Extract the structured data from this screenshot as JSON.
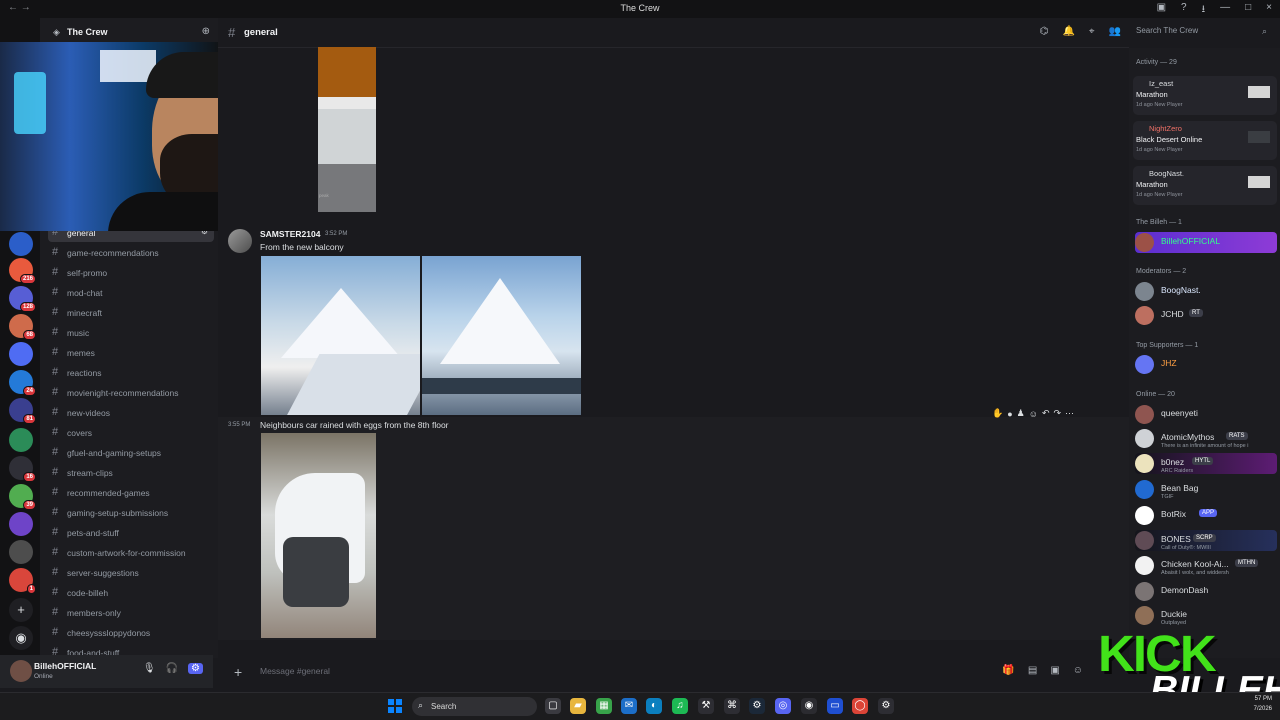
{
  "window": {
    "title": "The Crew",
    "nav": "←  →",
    "icons": [
      "inbox-icon",
      "help-icon",
      "download-icon",
      "minimize-icon",
      "maximize-icon",
      "close-icon"
    ]
  },
  "server": {
    "name": "The Crew",
    "add_icon": "add-member-icon"
  },
  "channels": [
    "general",
    "game-recommendations",
    "self-promo",
    "mod-chat",
    "minecraft",
    "music",
    "memes",
    "reactions",
    "movienight-recommendations",
    "new-videos",
    "covers",
    "gfuel-and-gaming-setups",
    "stream-clips",
    "recommended-games",
    "gaming-setup-submissions",
    "pets-and-stuff",
    "custom-artwork-for-commission",
    "server-suggestions",
    "code-billeh",
    "members-only",
    "cheesysssloppydonos",
    "food-and-stuff"
  ],
  "guild_badges": [
    "216",
    "128",
    "68",
    "24",
    "81",
    "16",
    "39",
    "1"
  ],
  "header": {
    "channel": "general",
    "search_placeholder": "Search The Crew"
  },
  "messages": [
    {
      "author": "SAMSTER2104",
      "time": "3:52 PM",
      "text": "From the new balcony"
    },
    {
      "time": "3:55 PM",
      "text": "Neighbours car rained with eggs from the 8th floor"
    }
  ],
  "images": {
    "top_caption": "peak"
  },
  "composer": {
    "placeholder": "Message #general"
  },
  "user": {
    "name": "BillehOFFICIAL",
    "status": "Online"
  },
  "members": {
    "activity_label": "Activity — 29",
    "activity": [
      {
        "user": "Iz_east",
        "game": "Marathon",
        "meta": "1d ago  New Player"
      },
      {
        "user": "NightZero",
        "game": "Black Desert Online",
        "meta": "1d ago  New Player"
      },
      {
        "user": "BoogNast.",
        "game": "Marathon",
        "meta": "1d ago  New Player"
      }
    ],
    "billeh_label": "The Billeh — 1",
    "billeh": {
      "name": "BillehOFFICIAL"
    },
    "moderators_label": "Moderators — 2",
    "moderators": [
      {
        "name": "BoogNast."
      },
      {
        "name": "JCHD",
        "tag": "RT"
      }
    ],
    "supporters_label": "Top Supporters — 1",
    "supporters": [
      {
        "name": "JHZ"
      }
    ],
    "online_label": "Online — 20",
    "online": [
      {
        "name": "queenyeti"
      },
      {
        "name": "AtomicMythos",
        "tag": "RATS",
        "sub": "There is an infinite amount of hope i"
      },
      {
        "name": "b0nez",
        "tag": "HYTL",
        "sub": "ARC Raiders"
      },
      {
        "name": "Bean Bag",
        "sub": "TGIF"
      },
      {
        "name": "BotRix",
        "tag": "APP"
      },
      {
        "name": "BONES",
        "tag": "SCRP",
        "sub": "Call of Duty®: MWIII"
      },
      {
        "name": "Chicken Kool-Ai...",
        "tag": "MTHN",
        "sub": "Abaisit I wolx, and widdersh"
      },
      {
        "name": "DemonDash"
      },
      {
        "name": "Duckie",
        "sub": "Outplayed"
      }
    ]
  },
  "taskbar": {
    "search": "Search",
    "time": "57 PM",
    "date": "7/2026"
  },
  "overlay": {
    "kick": "KICK",
    "name": "BILLEH"
  }
}
